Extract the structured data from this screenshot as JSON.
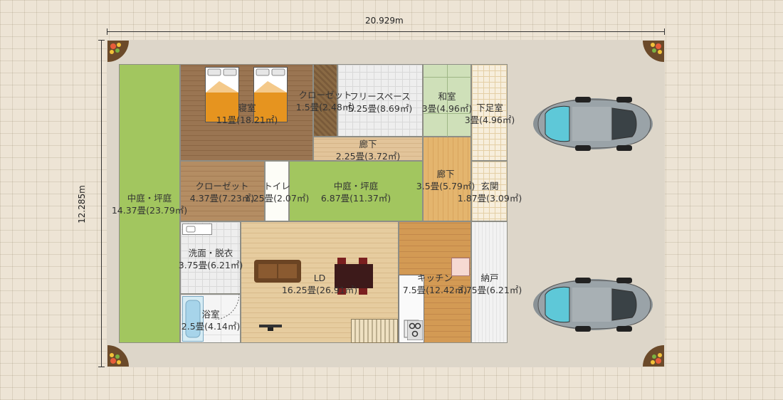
{
  "dimensions": {
    "width": "20.929m",
    "height": "12.285m"
  },
  "rooms": {
    "courtyard_left": {
      "name": "中庭・坪庭",
      "area": "14.37畳(23.79㎡)"
    },
    "bedroom": {
      "name": "寝室",
      "area": "11畳(18.21㎡)"
    },
    "closet_top": {
      "name": "クローゼット",
      "area": "1.5畳(2.48㎡)"
    },
    "free_space": {
      "name": "フリースペース",
      "area": "5.25畳(8.69㎡)"
    },
    "washitsu": {
      "name": "和室",
      "area": "3畳(4.96㎡)"
    },
    "shoe_room": {
      "name": "下足室",
      "area": "3畳(4.96㎡)"
    },
    "hallway_top": {
      "name": "廊下",
      "area": "2.25畳(3.72㎡)"
    },
    "closet_mid": {
      "name": "クローゼット",
      "area": "4.37畳(7.23㎡)"
    },
    "toilet": {
      "name": "トイレ",
      "area": "1.25畳(2.07㎡)"
    },
    "courtyard_center": {
      "name": "中庭・坪庭",
      "area": "6.87畳(11.37㎡)"
    },
    "hallway_right": {
      "name": "廊下",
      "area": "3.5畳(5.79㎡)"
    },
    "entrance": {
      "name": "玄関",
      "area": "1.87畳(3.09㎡)"
    },
    "washroom": {
      "name": "洗面・脱衣",
      "area": "3.75畳(6.21㎡)"
    },
    "ld": {
      "name": "LD",
      "area": "16.25畳(26.91㎡)"
    },
    "kitchen": {
      "name": "キッチン",
      "area": "7.5畳(12.42㎡)"
    },
    "storage": {
      "name": "納戸",
      "area": "3.75畳(6.21㎡)"
    },
    "bathroom": {
      "name": "浴室",
      "area": "2.5畳(4.14㎡)"
    }
  },
  "icons": [
    "plant-icon",
    "car-icon",
    "bed-icon",
    "sofa-icon",
    "dining-table-icon",
    "tv-icon",
    "stairs-icon",
    "sink-icon",
    "bathtub-icon",
    "stove-icon"
  ]
}
